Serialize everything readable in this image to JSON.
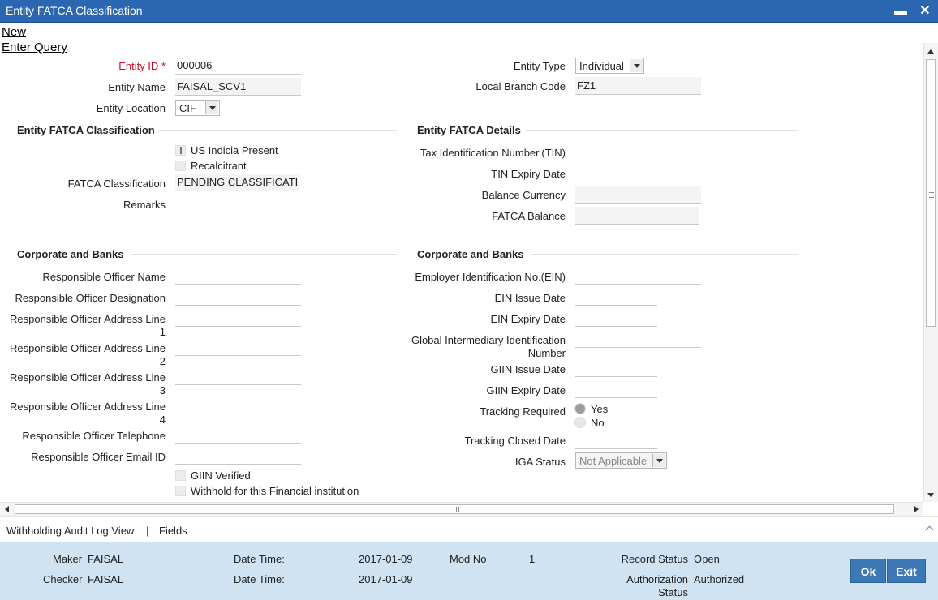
{
  "window": {
    "title": "Entity FATCA Classification"
  },
  "menu": {
    "new": "New",
    "enter_query": "Enter Query"
  },
  "header": {
    "entity_id_label": "Entity ID",
    "required_mark": "*",
    "entity_id_value": "000006",
    "entity_name_label": "Entity Name",
    "entity_name_value": "FAISAL_SCV1",
    "entity_location_label": "Entity Location",
    "entity_location_value": "CIF",
    "entity_type_label": "Entity Type",
    "entity_type_value": "Individual",
    "local_branch_label": "Local Branch Code",
    "local_branch_value": "FZ1"
  },
  "classification": {
    "title": "Entity FATCA Classification",
    "us_indicia_label": "US Indicia Present",
    "us_indicia_checked": true,
    "recalcitrant_label": "Recalcitrant",
    "recalcitrant_checked": false,
    "fatca_classification_label": "FATCA Classification",
    "fatca_classification_value": "PENDING CLASSIFICATIO",
    "remarks_label": "Remarks",
    "remarks_value": ""
  },
  "details": {
    "title": "Entity FATCA Details",
    "tin_label": "Tax Identification Number.(TIN)",
    "tin_value": "",
    "tin_expiry_label": "TIN Expiry Date",
    "tin_expiry_value": "",
    "balance_currency_label": "Balance Currency",
    "balance_currency_value": "",
    "fatca_balance_label": "FATCA Balance",
    "fatca_balance_value": ""
  },
  "corp_left": {
    "title": "Corporate and Banks",
    "officer_name_label": "Responsible Officer Name",
    "officer_designation_label": "Responsible Officer Designation",
    "address1_label_a": "Responsible Officer Address Line",
    "address1_label_b": "1",
    "address2_label_a": "Responsible Officer Address Line",
    "address2_label_b": "2",
    "address3_label_a": "Responsible Officer Address Line",
    "address3_label_b": "3",
    "address4_label_a": "Responsible Officer Address Line",
    "address4_label_b": "4",
    "telephone_label": "Responsible Officer Telephone",
    "email_label": "Responsible Officer Email ID",
    "giin_verified_label": "GIIN Verified",
    "withhold_label": "Withhold for this Financial institution"
  },
  "corp_right": {
    "title": "Corporate and Banks",
    "ein_label": "Employer Identification No.(EIN)",
    "ein_issue_label": "EIN Issue Date",
    "ein_expiry_label": "EIN Expiry Date",
    "giin_label_a": "Global Intermediary Identification",
    "giin_label_b": "Number",
    "giin_issue_label": "GIIN Issue Date",
    "giin_expiry_label": "GIIN Expiry Date",
    "tracking_required_label": "Tracking Required",
    "tracking_yes": "Yes",
    "tracking_no": "No",
    "tracking_selected": "Yes",
    "tracking_closed_label": "Tracking Closed Date",
    "iga_status_label": "IGA Status",
    "iga_status_value": "Not Applicable"
  },
  "links": {
    "withholding_audit": "Withholding Audit Log View",
    "separator": "|",
    "fields": "Fields"
  },
  "footer": {
    "maker_label": "Maker",
    "maker_value": "FAISAL",
    "checker_label": "Checker",
    "checker_value": "FAISAL",
    "datetime_label_1": "Date Time:",
    "datetime_value_1": "2017-01-09",
    "datetime_label_2": "Date Time:",
    "datetime_value_2": "2017-01-09",
    "mod_no_label": "Mod No",
    "mod_no_value": "1",
    "record_status_label": "Record Status",
    "record_status_value": "Open",
    "auth_status_label_a": "Authorization",
    "auth_status_label_b": "Status",
    "auth_status_value": "Authorized",
    "ok_label": "Ok",
    "exit_label": "Exit"
  },
  "colors": {
    "titlebar": "#2a67b0",
    "footer": "#cfe3f2",
    "button": "#3d78b6",
    "required": "#c8102e"
  }
}
